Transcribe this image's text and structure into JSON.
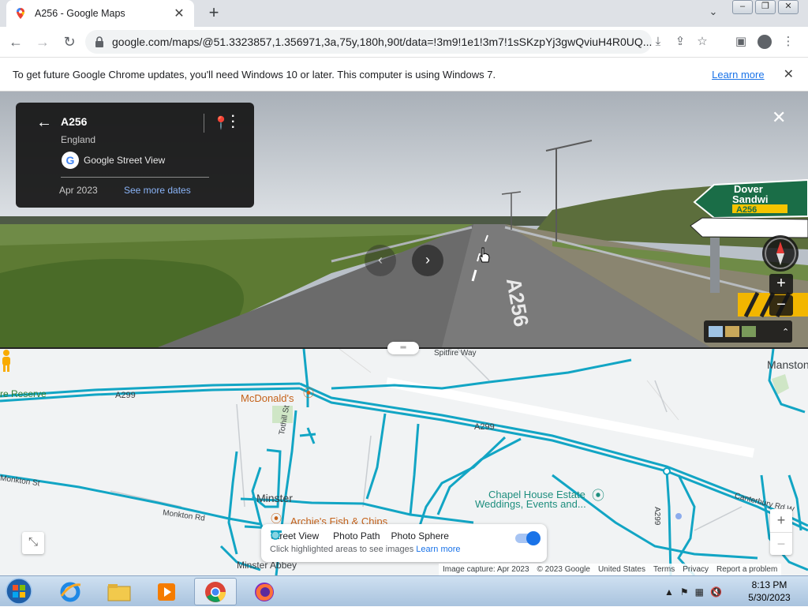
{
  "browser": {
    "tab_title": "A256 - Google Maps",
    "tab_close": "✕",
    "new_tab": "+",
    "url": "google.com/maps/@51.3323857,1.356971,3a,75y,180h,90t/data=!3m9!1e1!3m7!1sSKzpYj3gwQviuH4R0UQ...",
    "infobar_message": "To get future Google Chrome updates, you'll need Windows 10 or later. This computer is using Windows 7.",
    "infobar_link": "Learn more",
    "infobar_close": "✕"
  },
  "streetview": {
    "title": "A256",
    "subtitle": "England",
    "source": "Google Street View",
    "date": "Apr 2023",
    "see_more_dates": "See more dates",
    "close": "✕",
    "zoom_in": "+",
    "zoom_out": "−",
    "sign_line1": "Dover",
    "sign_line2": "Sandwi",
    "sign_road": "A256",
    "road_marking": "A256"
  },
  "map": {
    "labels": {
      "reserve": "re Reserve",
      "a299_left": "A299",
      "a299_mid": "A299",
      "a299_right": "A299",
      "mcdonalds": "McDonald's",
      "spitfire": "Spitfire Way",
      "manston": "Manston",
      "monkton_st": "Monkton St",
      "monkton_rd": "Monkton Rd",
      "tothill": "Tothill St",
      "minster": "Minster",
      "archies": "Archie's Fish & Chips",
      "minster_abbey": "Minster Abbey",
      "chapel_line1": "Chapel House Estate",
      "chapel_line2": "Weddings, Events and...",
      "canterbury_rd": "Canterbury Rd W"
    },
    "legend": {
      "street_view": "Street View",
      "photo_path": "Photo Path",
      "photo_sphere": "Photo Sphere",
      "hint": "Click highlighted areas to see images",
      "learn_more": "Learn more",
      "toggle_on": true
    },
    "zoom_in": "+",
    "zoom_out": "−",
    "attribution": {
      "capture": "Image capture: Apr 2023",
      "copyright": "© 2023 Google",
      "region": "United States",
      "terms": "Terms",
      "privacy": "Privacy",
      "report": "Report a problem"
    }
  },
  "taskbar": {
    "time": "8:13 PM",
    "date": "5/30/2023"
  },
  "colors": {
    "street_view_line": "#12a5c4",
    "chrome_tabstrip": "#dee1e6",
    "link_blue": "#1a73e8"
  }
}
